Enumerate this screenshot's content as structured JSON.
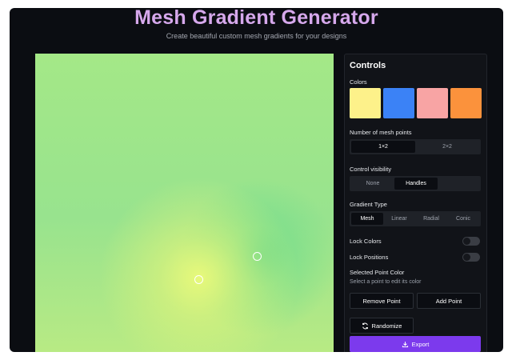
{
  "header": {
    "title": "Mesh Gradient Generator",
    "subtitle": "Create beautiful custom mesh gradients for your designs"
  },
  "canvas": {
    "mesh_colors": [
      "#a4e887",
      "#ecfa7a",
      "#60d68c",
      "#b8ea84"
    ],
    "handles": [
      "handle-1",
      "handle-2"
    ]
  },
  "controls": {
    "title": "Controls",
    "colors": {
      "label": "Colors",
      "swatches": [
        "#fdf18a",
        "#3b82f6",
        "#f8a4a4",
        "#fb923c"
      ]
    },
    "mesh_points": {
      "label": "Number of mesh points",
      "options": [
        "1×2",
        "2×2"
      ],
      "selected": "1×2"
    },
    "visibility": {
      "label": "Control visibility",
      "options": [
        "None",
        "Handles"
      ],
      "selected": "Handles"
    },
    "gradient_type": {
      "label": "Gradient Type",
      "options": [
        "Mesh",
        "Linear",
        "Radial",
        "Conic"
      ],
      "selected": "Mesh"
    },
    "lock_colors": {
      "label": "Lock Colors",
      "on": false
    },
    "lock_positions": {
      "label": "Lock Positions",
      "on": false
    },
    "selected_point": {
      "label": "Selected Point Color",
      "hint": "Select a point to edit its color"
    },
    "buttons": {
      "remove_point": "Remove Point",
      "add_point": "Add Point",
      "randomize": "Randomize",
      "export": "Export"
    },
    "accent_color": "#7c3aed"
  }
}
